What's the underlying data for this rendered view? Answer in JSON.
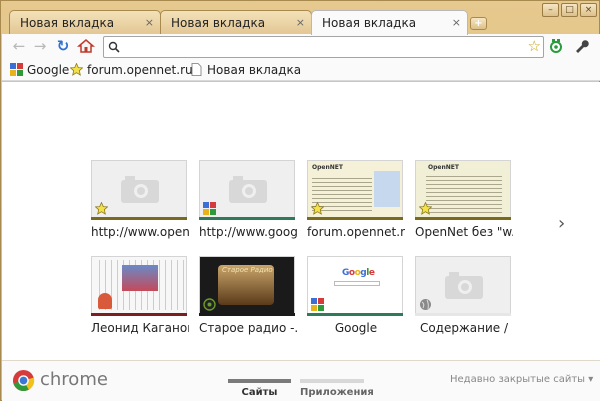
{
  "window": {
    "controls": {
      "minimize": "–",
      "maximize": "□",
      "close": "×"
    }
  },
  "tabs": [
    {
      "label": "Новая вкладка",
      "close": "×",
      "active": false
    },
    {
      "label": "Новая вкладка",
      "close": "×",
      "active": false
    },
    {
      "label": "Новая вкладка",
      "close": "×",
      "active": true
    }
  ],
  "new_tab_label": "+",
  "toolbar": {
    "back_icon": "←",
    "forward_icon": "→",
    "reload_icon": "↻",
    "home_icon": "home-icon",
    "address_value": "",
    "address_placeholder": "",
    "star_icon": "☆",
    "extension_icon": "extension-icon",
    "wrench_icon": "wrench-icon"
  },
  "bookmarks": [
    {
      "label": "Google",
      "icon": "google-favicon"
    },
    {
      "label": "forum.opennet.ru",
      "icon": "star-favicon"
    },
    {
      "label": "Новая вкладка",
      "icon": "page-icon"
    }
  ],
  "most_visited": [
    {
      "caption": "http://www.openn...",
      "thumb": "placeholder",
      "favicon": "star",
      "bar": "#7a6a1e"
    },
    {
      "caption": "http://www.google...",
      "thumb": "placeholder",
      "favicon": "google",
      "bar": "#2f7a5a"
    },
    {
      "caption": "forum.opennet.ru/...",
      "thumb": "opennet",
      "favicon": "star",
      "bar": "#7a6a1e"
    },
    {
      "caption": "OpenNet без \"w...",
      "thumb": "opennet2",
      "favicon": "star",
      "bar": "#7a6a1e"
    },
    {
      "caption": "Леонид Каганов...",
      "thumb": "kaganov",
      "favicon": "none",
      "bar": "#7a1e1e"
    },
    {
      "caption": "Старое радио -...",
      "thumb": "radio",
      "favicon": "radio",
      "bar": "#1a1a1a"
    },
    {
      "caption": "Google",
      "thumb": "google",
      "favicon": "google",
      "bar": "#2f7a5a"
    },
    {
      "caption": "Содержание /",
      "thumb": "placeholder",
      "favicon": "globe",
      "bar": "#e6e6e6"
    }
  ],
  "next_arrow": "›",
  "footer": {
    "logo_text": "chrome",
    "sections": [
      {
        "label": "Сайты",
        "active": true
      },
      {
        "label": "Приложения",
        "active": false
      }
    ],
    "recently_closed": "Недавно закрытые сайты",
    "recently_closed_arrow": "▾"
  },
  "colors": {
    "frame": "#e0c184",
    "toolbar": "#fafafa",
    "active_indicator": "#7a7a7a"
  }
}
